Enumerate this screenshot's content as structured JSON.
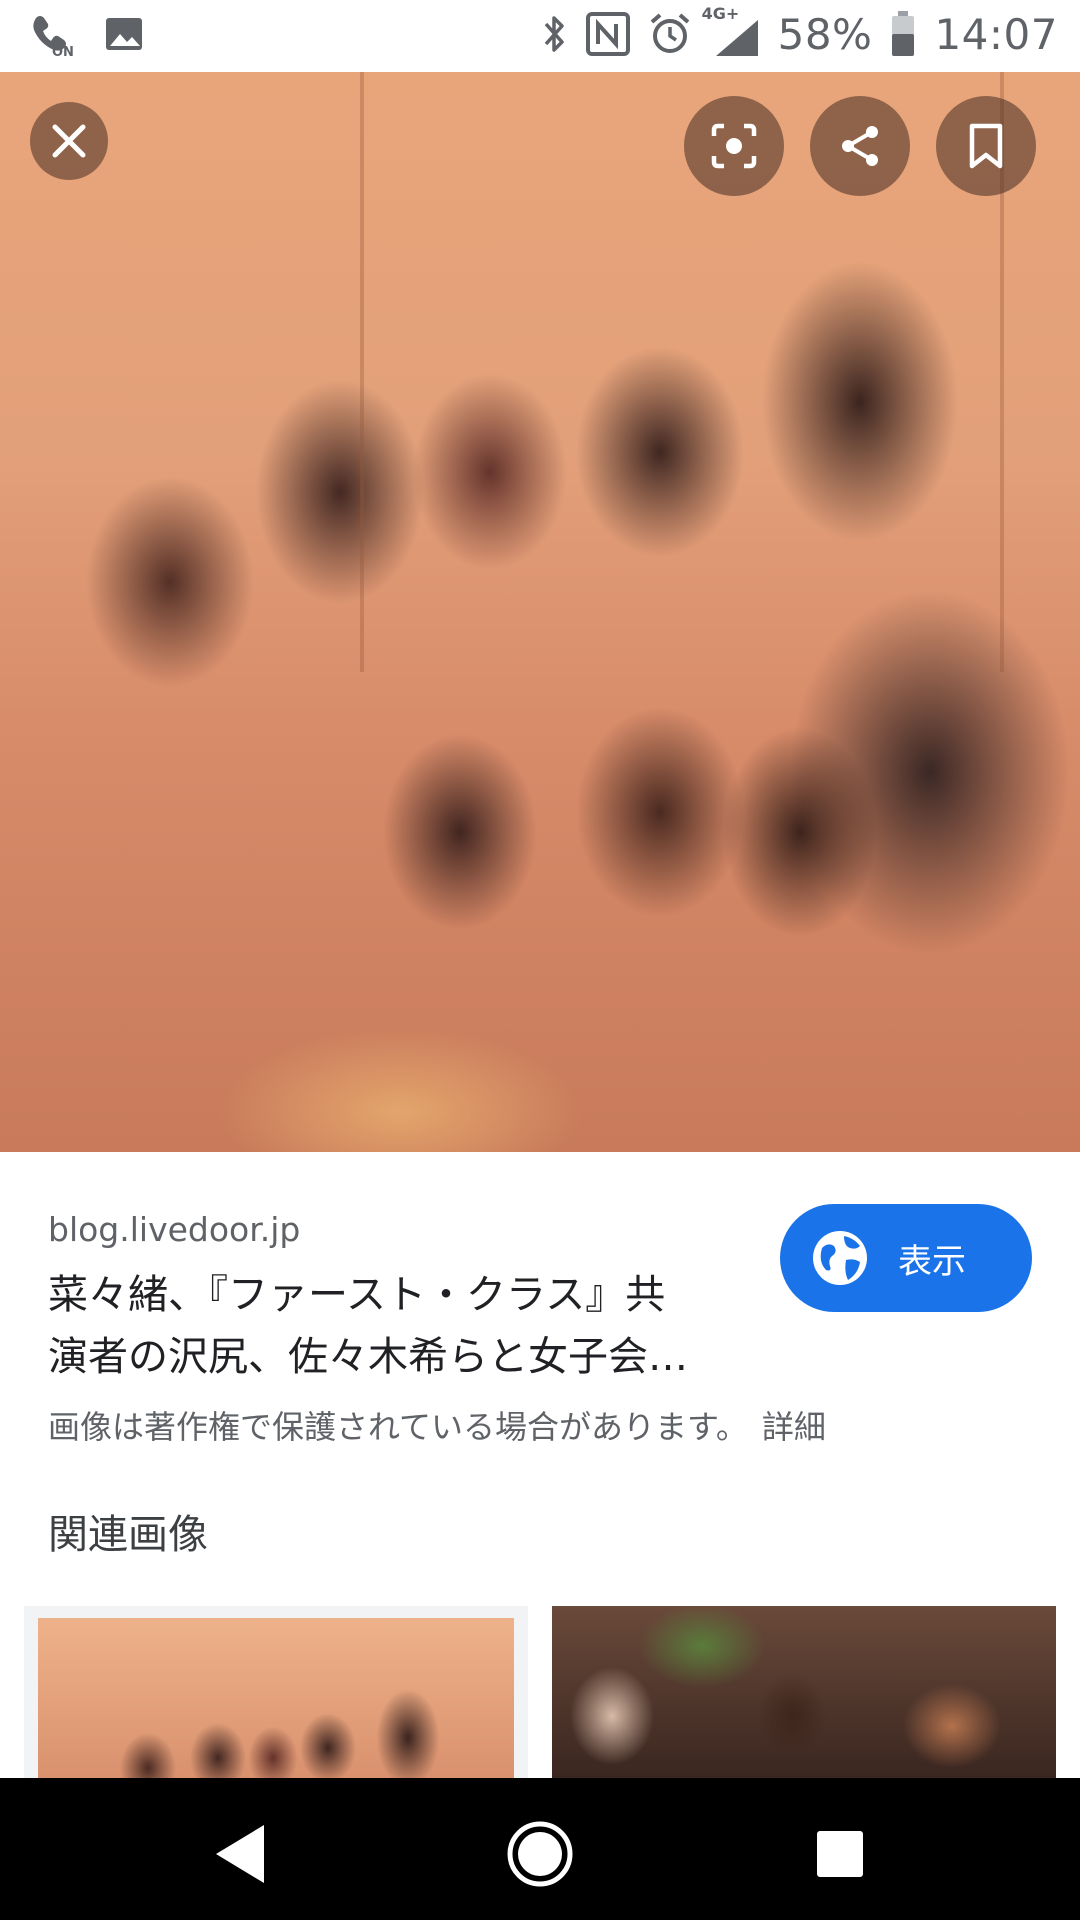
{
  "status_bar": {
    "icons_left": [
      "volte-on-icon",
      "image-notification-icon"
    ],
    "icons_right": [
      "bluetooth-icon",
      "nfc-icon",
      "alarm-icon",
      "signal-4g-icon",
      "battery-icon"
    ],
    "network": "4G+",
    "battery": "58%",
    "time": "14:07"
  },
  "viewer": {
    "close_icon": "close-icon",
    "lens_icon": "lens-search-icon",
    "share_icon": "share-icon",
    "save_icon": "bookmark-icon"
  },
  "result": {
    "source": "blog.livedoor.jp",
    "title_line1": "菜々緒、『ファースト・クラス』共",
    "title_line2": "演者の沢尻、佐々木希らと女子会…",
    "view_button": "表示",
    "copyright_text": "画像は著作権で保護されている場合があります。",
    "details_link": "詳細",
    "related_heading": "関連画像"
  },
  "nav": {
    "back": "back-icon",
    "home": "home-icon",
    "recents": "recents-icon"
  },
  "colors": {
    "accent": "#1a73e8",
    "text_primary": "#202124",
    "text_secondary": "#5f6368"
  }
}
